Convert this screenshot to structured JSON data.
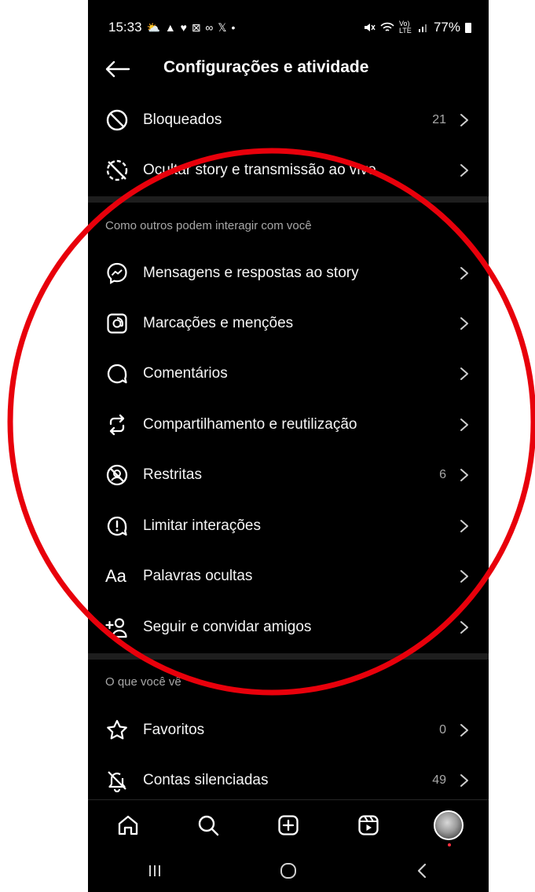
{
  "status_bar": {
    "time": "15:33",
    "notification_icons": "⛅ ▲ ♥ ⊠ ∞ 𝕏 •",
    "signal_text": "Vo) LTE",
    "battery": "77%"
  },
  "header": {
    "title": "Configurações e atividade"
  },
  "rows_top": [
    {
      "label": "Bloqueados",
      "count": "21"
    },
    {
      "label": "Ocultar story e transmissão ao vivo",
      "count": ""
    }
  ],
  "section_interact": {
    "title": "Como outros podem interagir com você",
    "items": [
      {
        "label": "Mensagens e respostas ao story",
        "count": ""
      },
      {
        "label": "Marcações e menções",
        "count": ""
      },
      {
        "label": "Comentários",
        "count": ""
      },
      {
        "label": "Compartilhamento e reutilização",
        "count": ""
      },
      {
        "label": "Restritas",
        "count": "6"
      },
      {
        "label": "Limitar interações",
        "count": ""
      },
      {
        "label": "Palavras ocultas",
        "count": ""
      },
      {
        "label": "Seguir e convidar amigos",
        "count": ""
      }
    ]
  },
  "section_see": {
    "title": "O que você vê",
    "items": [
      {
        "label": "Favoritos",
        "count": "0"
      },
      {
        "label": "Contas silenciadas",
        "count": "49"
      }
    ]
  },
  "icons": {
    "hidden_words": "Aa"
  },
  "colors": {
    "background": "#000000",
    "text": "#f5f5f5",
    "secondary_text": "#a8a8a8",
    "annotation": "#e8000b"
  }
}
